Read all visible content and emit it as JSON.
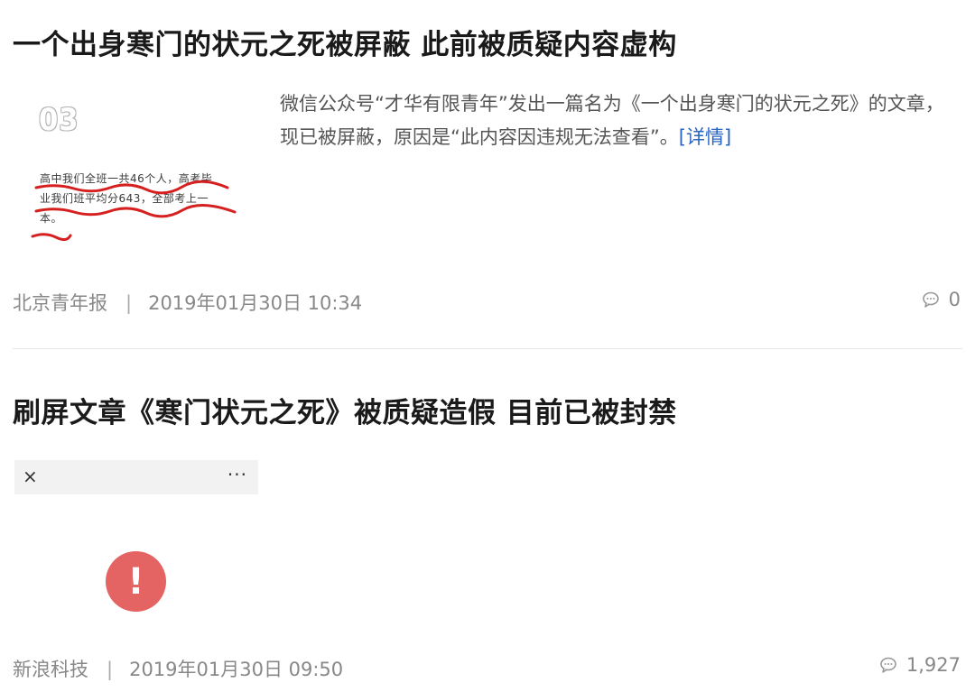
{
  "articles": [
    {
      "title": "一个出身寒门的状元之死被屏蔽 此前被质疑内容虚构",
      "summary": "微信公众号“才华有限青年”发出一篇名为《一个出身寒门的状元之死》的文章，现已被屏蔽，原因是“此内容因违规无法查看”。",
      "more_label": "[详情]",
      "source": "北京青年报",
      "separator": "|",
      "datetime": "2019年01月30日  10:34",
      "comments": "0",
      "thumbnail": {
        "number_label": "03",
        "handwriting_lines": [
          "高中我们全班一共46个人，高考毕",
          "业我们班平均分643，全部考上一",
          "本。"
        ]
      }
    },
    {
      "title": "刷屏文章《寒门状元之死》被质疑造假 目前已被封禁",
      "source": "新浪科技",
      "separator": "|",
      "datetime": "2019年01月30日  09:50",
      "comments": "1,927",
      "thumbnail": {
        "close_glyph": "×",
        "more_glyph": "···",
        "alert_glyph": "!"
      }
    }
  ],
  "icons": {
    "comment": "comment-bubble-icon",
    "alert": "exclamation-circle-icon"
  },
  "colors": {
    "link": "#2a65c2",
    "alert": "#e46464",
    "underline": "#d62020",
    "meta": "#888888"
  }
}
